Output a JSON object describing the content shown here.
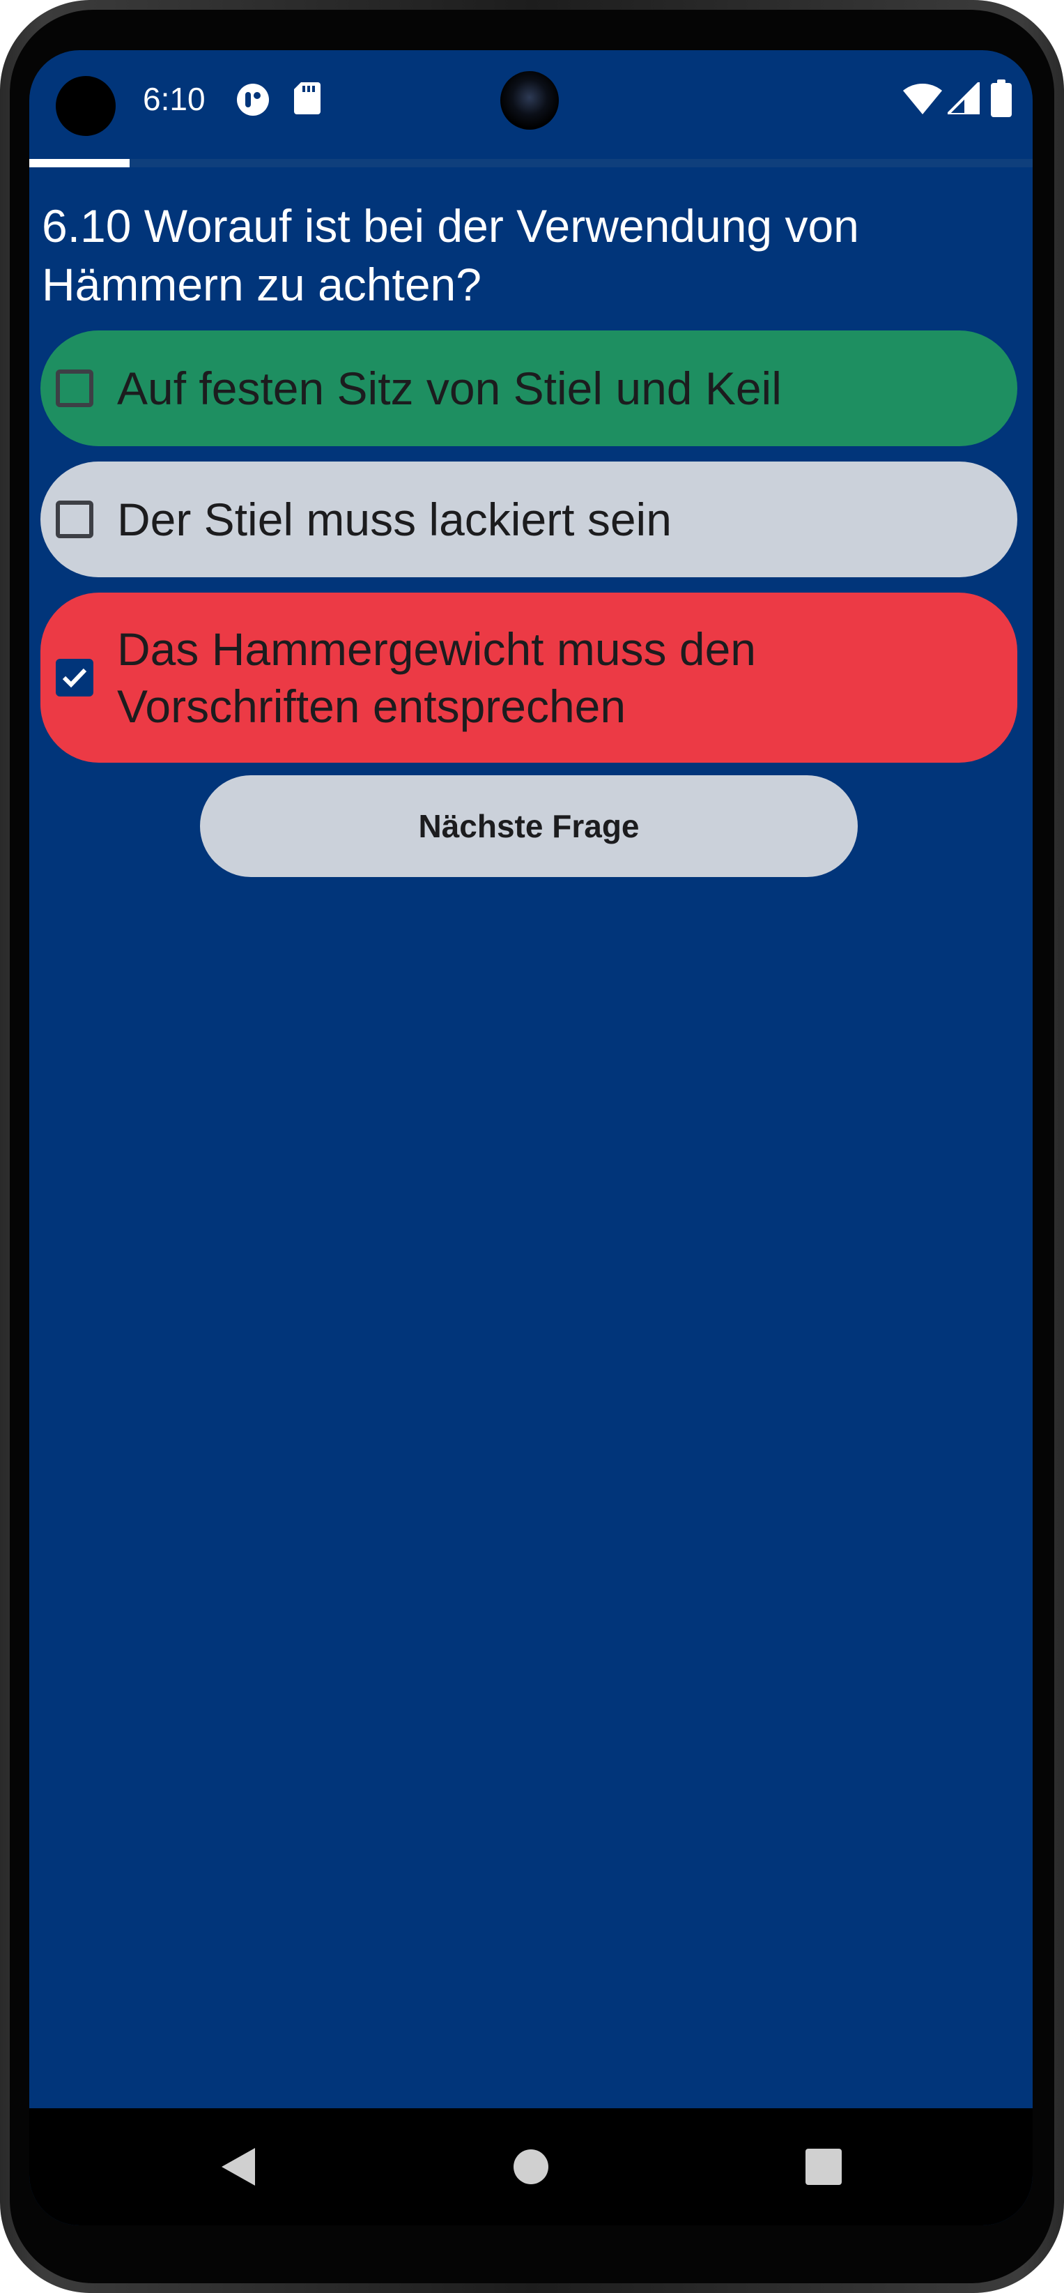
{
  "status_bar": {
    "time": "6:10",
    "icons": [
      "assistant-icon",
      "sd-card-icon",
      "wifi-icon",
      "signal-icon",
      "battery-icon"
    ]
  },
  "progress": {
    "fraction": 0.1
  },
  "question": {
    "text": "6.10 Worauf ist bei der Verwendung von Hämmern zu achten?"
  },
  "answers": [
    {
      "label": "Auf festen Sitz von Stiel und Keil",
      "checked": false,
      "state": "correct",
      "color": "#1e8f61"
    },
    {
      "label": "Der Stiel muss lackiert sein",
      "checked": false,
      "state": "neutral",
      "color": "#cbd1da"
    },
    {
      "label": "Das Hammergewicht muss den Vorschriften entsprechen",
      "checked": true,
      "state": "wrong",
      "color": "#ec3a45"
    }
  ],
  "next_button": {
    "label": "Nächste Frage",
    "color": "#cbd1da"
  },
  "colors": {
    "background": "#01357a",
    "checkbox_checked": "#01357a"
  },
  "navigation": {
    "icons": [
      "back-icon",
      "home-icon",
      "recents-icon"
    ]
  }
}
